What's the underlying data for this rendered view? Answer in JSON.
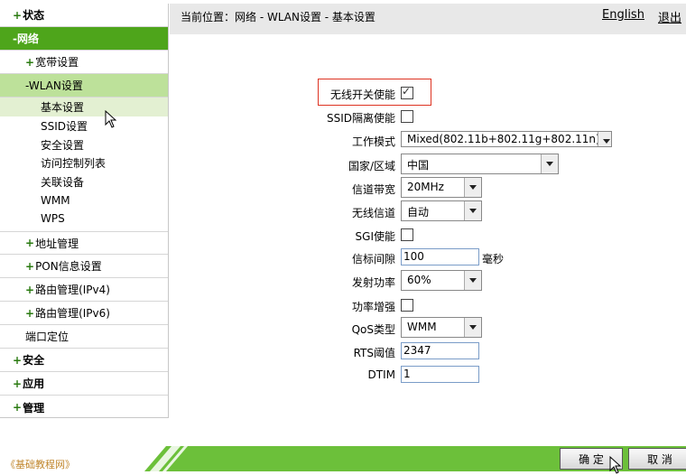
{
  "sidebar": {
    "status": "状态",
    "network": "-网络",
    "broadband": "宽带设置",
    "wlan": "-WLAN设置",
    "wlan_leaves": [
      "基本设置",
      "SSID设置",
      "安全设置",
      "访问控制列表",
      "关联设备",
      "WMM",
      "WPS"
    ],
    "address": "地址管理",
    "pon": "PON信息设置",
    "route4": "路由管理(IPv4)",
    "route6": "路由管理(IPv6)",
    "port": "端口定位",
    "security": "安全",
    "apps": "应用",
    "manage": "管理"
  },
  "header": {
    "breadcrumb": "当前位置：网络 - WLAN设置 - 基本设置",
    "english": "English",
    "logout": "退出"
  },
  "form": {
    "wireless_enable": {
      "label": "无线开关使能",
      "checked": true
    },
    "ssid_isolation": {
      "label": "SSID隔离使能",
      "checked": false
    },
    "work_mode": {
      "label": "工作模式",
      "value": "Mixed(802.11b+802.11g+802.11n)"
    },
    "country": {
      "label": "国家/区域",
      "value": "中国"
    },
    "bandwidth": {
      "label": "信道带宽",
      "value": "20MHz"
    },
    "channel": {
      "label": "无线信道",
      "value": "自动"
    },
    "sgi": {
      "label": "SGI使能",
      "checked": false
    },
    "beacon": {
      "label": "信标间隙",
      "value": "100",
      "unit": "毫秒"
    },
    "tx_power": {
      "label": "发射功率",
      "value": "60%"
    },
    "power_boost": {
      "label": "功率增强",
      "checked": false
    },
    "qos": {
      "label": "QoS类型",
      "value": "WMM"
    },
    "rts": {
      "label": "RTS阈值",
      "value": "2347"
    },
    "dtim": {
      "label": "DTIM",
      "value": "1"
    }
  },
  "buttons": {
    "ok": "确 定",
    "cancel": "取 消"
  },
  "watermark": "《基础教程网》",
  "colors": {
    "accent": "#4ea51b",
    "highlight_box": "#dd3322"
  }
}
